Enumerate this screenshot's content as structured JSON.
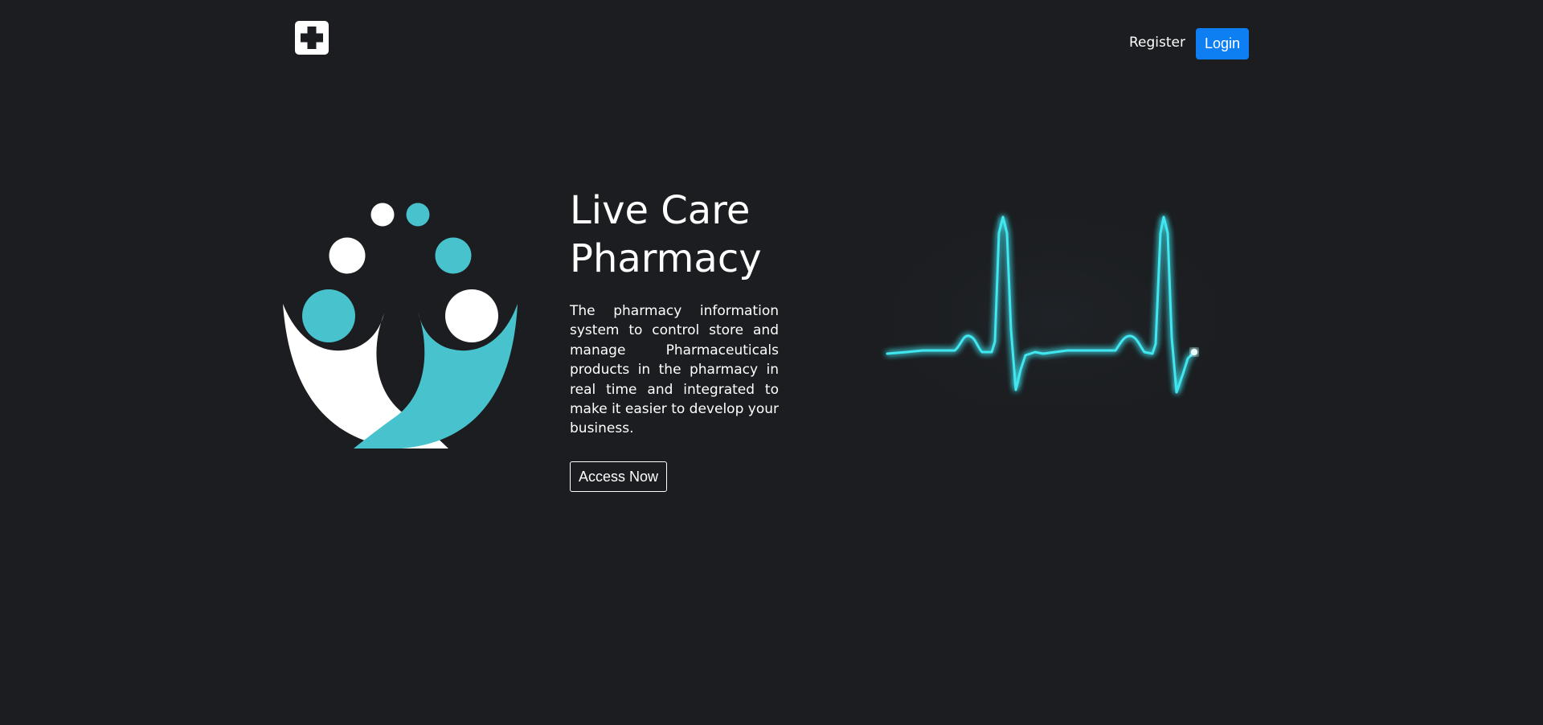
{
  "navbar": {
    "logo_icon": "medical-cross-icon",
    "register_label": "Register",
    "login_label": "Login"
  },
  "hero": {
    "logo_icon": "community-people-logo-icon",
    "title_line1": "Live Care",
    "title_line2": "Pharmacy",
    "description": "The pharmacy information system to control store and manage Pharmaceuticals products in the pharmacy in real time and integrated to make it easier to develop your business.",
    "access_button_label": "Access Now",
    "heartbeat_icon": "heartbeat-line-icon"
  },
  "colors": {
    "background": "#1b1d20",
    "accent_teal": "#48c3cd",
    "login_blue": "#0d7ff2",
    "heartbeat_glow": "#3fe6f0",
    "text": "#ffffff"
  }
}
